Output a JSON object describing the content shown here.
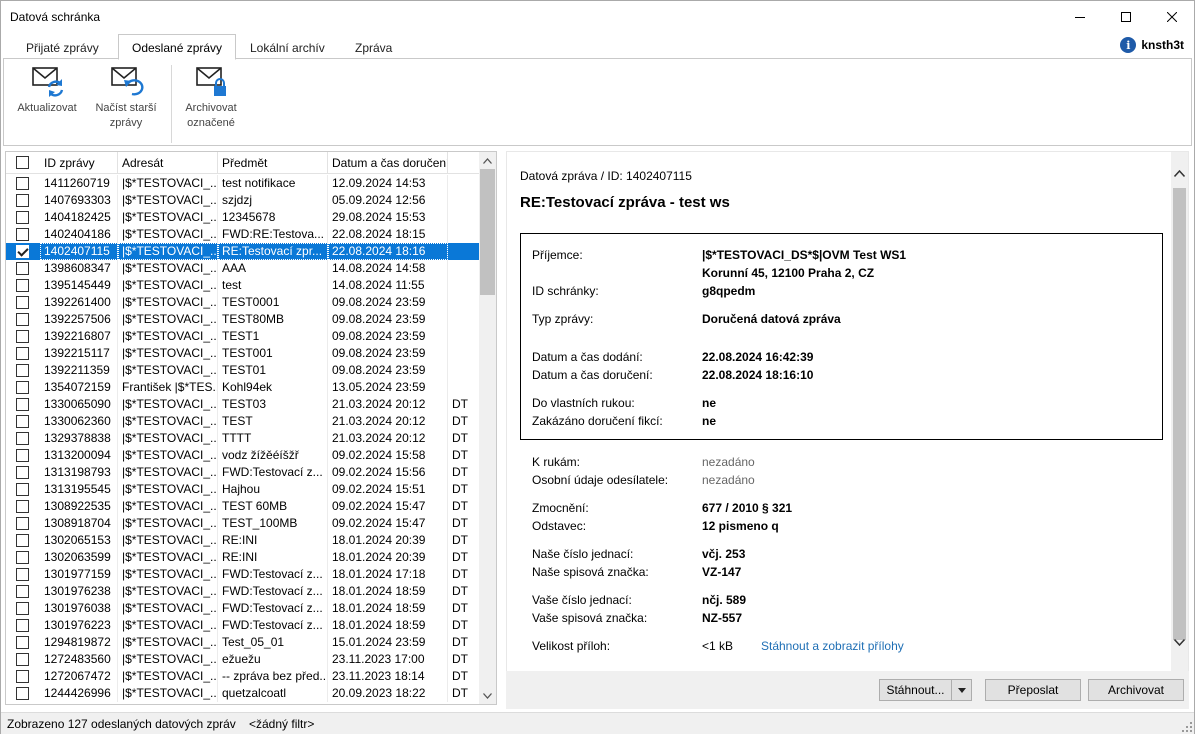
{
  "window": {
    "title": "Datová schránka"
  },
  "tabs": [
    {
      "label": "Přijaté zprávy",
      "active": false
    },
    {
      "label": "Odeslané zprávy",
      "active": true
    },
    {
      "label": "Lokální archív",
      "active": false
    },
    {
      "label": "Zpráva",
      "active": false
    }
  ],
  "user": {
    "name": "knsth3t",
    "icon": "info-icon"
  },
  "ribbon": {
    "refresh": {
      "line1": "Aktualizovat",
      "line2": "",
      "icon": "mail-refresh-icon"
    },
    "load_older": {
      "line1": "Načíst starší",
      "line2": "zprávy",
      "icon": "mail-undo-icon"
    },
    "archive": {
      "line1": "Archivovat",
      "line2": "označené",
      "icon": "mail-lock-icon"
    }
  },
  "list": {
    "columns": {
      "id": "ID zprávy",
      "to": "Adresát",
      "subject": "Předmět",
      "date": "Datum a čas doručení"
    },
    "rows": [
      {
        "id": "1411260719",
        "to": "|$*TESTOVACI_...",
        "subject": "test notifikace",
        "date": "12.09.2024 14:53",
        "flag": ""
      },
      {
        "id": "1407693303",
        "to": "|$*TESTOVACI_...",
        "subject": "szjdzj",
        "date": "05.09.2024 12:56",
        "flag": ""
      },
      {
        "id": "1404182425",
        "to": "|$*TESTOVACI_...",
        "subject": "12345678",
        "date": "29.08.2024 15:53",
        "flag": ""
      },
      {
        "id": "1402404186",
        "to": "|$*TESTOVACI_...",
        "subject": "FWD:RE:Testova...",
        "date": "22.08.2024 18:15",
        "flag": ""
      },
      {
        "id": "1402407115",
        "to": "|$*TESTOVACI_...",
        "subject": "RE:Testovací zpr...",
        "date": "22.08.2024 18:16",
        "flag": "",
        "selected": true
      },
      {
        "id": "1398608347",
        "to": "|$*TESTOVACI_...",
        "subject": "AAA",
        "date": "14.08.2024 14:58",
        "flag": ""
      },
      {
        "id": "1395145449",
        "to": "|$*TESTOVACI_...",
        "subject": "test",
        "date": "14.08.2024 11:55",
        "flag": ""
      },
      {
        "id": "1392261400",
        "to": "|$*TESTOVACI_...",
        "subject": "TEST0001",
        "date": "09.08.2024 23:59",
        "flag": ""
      },
      {
        "id": "1392257506",
        "to": "|$*TESTOVACI_...",
        "subject": "TEST80MB",
        "date": "09.08.2024 23:59",
        "flag": ""
      },
      {
        "id": "1392216807",
        "to": "|$*TESTOVACI_...",
        "subject": "TEST1",
        "date": "09.08.2024 23:59",
        "flag": ""
      },
      {
        "id": "1392215117",
        "to": "|$*TESTOVACI_...",
        "subject": "TEST001",
        "date": "09.08.2024 23:59",
        "flag": ""
      },
      {
        "id": "1392211359",
        "to": "|$*TESTOVACI_...",
        "subject": "TEST01",
        "date": "09.08.2024 23:59",
        "flag": ""
      },
      {
        "id": "1354072159",
        "to": "František |$*TES...",
        "subject": "Kohl94ek",
        "date": "13.05.2024 23:59",
        "flag": ""
      },
      {
        "id": "1330065090",
        "to": "|$*TESTOVACI_...",
        "subject": "TEST03",
        "date": "21.03.2024 20:12",
        "flag": "DT"
      },
      {
        "id": "1330062360",
        "to": "|$*TESTOVACI_...",
        "subject": "TEST",
        "date": "21.03.2024 20:12",
        "flag": "DT"
      },
      {
        "id": "1329378838",
        "to": "|$*TESTOVACI_...",
        "subject": "TTTT",
        "date": "21.03.2024 20:12",
        "flag": "DT"
      },
      {
        "id": "1313200094",
        "to": "|$*TESTOVACI_...",
        "subject": "vodz žížěéíšžř",
        "date": "09.02.2024 15:58",
        "flag": "DT"
      },
      {
        "id": "1313198793",
        "to": "|$*TESTOVACI_...",
        "subject": "FWD:Testovací z...",
        "date": "09.02.2024 15:56",
        "flag": "DT"
      },
      {
        "id": "1313195545",
        "to": "|$*TESTOVACI_...",
        "subject": "Hajhou",
        "date": "09.02.2024 15:51",
        "flag": "DT"
      },
      {
        "id": "1308922535",
        "to": "|$*TESTOVACI_...",
        "subject": "TEST 60MB",
        "date": "09.02.2024 15:47",
        "flag": "DT"
      },
      {
        "id": "1308918704",
        "to": "|$*TESTOVACI_...",
        "subject": "TEST_100MB",
        "date": "09.02.2024 15:47",
        "flag": "DT"
      },
      {
        "id": "1302065153",
        "to": "|$*TESTOVACI_...",
        "subject": "RE:INI",
        "date": "18.01.2024 20:39",
        "flag": "DT"
      },
      {
        "id": "1302063599",
        "to": "|$*TESTOVACI_...",
        "subject": "RE:INI",
        "date": "18.01.2024 20:39",
        "flag": "DT"
      },
      {
        "id": "1301977159",
        "to": "|$*TESTOVACI_...",
        "subject": "FWD:Testovací z...",
        "date": "18.01.2024 17:18",
        "flag": "DT"
      },
      {
        "id": "1301976238",
        "to": "|$*TESTOVACI_...",
        "subject": "FWD:Testovací z...",
        "date": "18.01.2024 18:59",
        "flag": "DT"
      },
      {
        "id": "1301976038",
        "to": "|$*TESTOVACI_...",
        "subject": "FWD:Testovací z...",
        "date": "18.01.2024 18:59",
        "flag": "DT"
      },
      {
        "id": "1301976223",
        "to": "|$*TESTOVACI_...",
        "subject": "FWD:Testovací z...",
        "date": "18.01.2024 18:59",
        "flag": "DT"
      },
      {
        "id": "1294819872",
        "to": "|$*TESTOVACI_...",
        "subject": "Test_05_01",
        "date": "15.01.2024 23:59",
        "flag": "DT"
      },
      {
        "id": "1272483560",
        "to": "|$*TESTOVACI_...",
        "subject": "ežuežu",
        "date": "23.11.2023 17:00",
        "flag": "DT"
      },
      {
        "id": "1272067472",
        "to": "|$*TESTOVACI_...",
        "subject": "-- zpráva bez před...",
        "date": "23.11.2023 18:14",
        "flag": "DT"
      },
      {
        "id": "1244426996",
        "to": "|$*TESTOVACI_...",
        "subject": "quetzalcoatl",
        "date": "20.09.2023 18:22",
        "flag": "DT"
      }
    ]
  },
  "detail": {
    "header": "Datová zpráva / ID: 1402407115",
    "subject": "RE:Testovací zpráva - test ws",
    "recipient_label": "Příjemce:",
    "recipient_name": "|$*TESTOVACI_DS*$|OVM Test WS1",
    "recipient_address": "Korunní 45, 12100 Praha 2, CZ",
    "box_id_label": "ID schránky:",
    "box_id": "g8qpedm",
    "type_label": "Typ zprávy:",
    "type": "Doručená datová zpráva",
    "delivered_label": "Datum a čas dodání:",
    "delivered": "22.08.2024 16:42:39",
    "accepted_label": "Datum a čas doručení:",
    "accepted": "22.08.2024 18:16:10",
    "personal_label": "Do vlastních rukou:",
    "personal": "ne",
    "fiction_label": "Zakázáno doručení fikcí:",
    "fiction": "ne",
    "attn_label": "K rukám:",
    "attn": "nezadáno",
    "sender_label": "Osobní údaje odesílatele:",
    "sender": "nezadáno",
    "auth_label": "Zmocnění:",
    "auth": "677 / 2010 § 321",
    "para_label": "Odstavec:",
    "para": "12 pismeno q",
    "our_ref_label": "Naše číslo jednací:",
    "our_ref": "včj. 253",
    "our_file_label": "Naše spisová značka:",
    "our_file": "VZ-147",
    "your_ref_label": "Vaše číslo jednací:",
    "your_ref": "nčj. 589",
    "your_file_label": "Vaše spisová značka:",
    "your_file": "NZ-557",
    "size_label": "Velikost příloh:",
    "size": "<1 kB",
    "download_link": "Stáhnout a zobrazit přílohy"
  },
  "actions": {
    "download": "Stáhnout...",
    "forward": "Přeposlat",
    "archive": "Archivovat"
  },
  "status": {
    "count": "Zobrazeno 127 odeslaných datových zpráv",
    "filter": "<žádný filtr>"
  },
  "colors": {
    "selection": "#0a78d7",
    "link": "#1f6fb5",
    "icon_blue": "#1e78d2"
  }
}
